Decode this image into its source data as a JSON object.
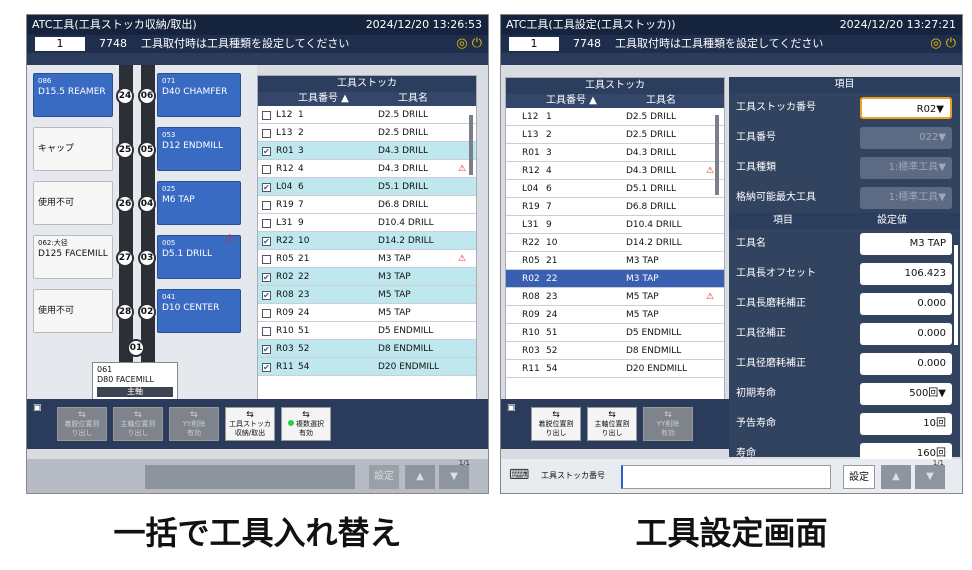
{
  "screen1": {
    "title": "ATC工具(工具ストッカ収納/取出)",
    "datetime": "2024/12/20 13:26:53",
    "number": "1",
    "code": "7748",
    "message": "工具取付時は工具種類を設定してください",
    "magazine": [
      {
        "name": "D15.5 REAMER",
        "pot_small": "086",
        "pot": "24",
        "blue": true
      },
      {
        "name": "D40 CHAMFER",
        "pot_small": "071",
        "pot": "06",
        "blue": true
      },
      {
        "name": "キャップ",
        "pot": "25",
        "blue": false
      },
      {
        "name": "D12 ENDMILL",
        "pot_small": "053",
        "pot": "05",
        "blue": true
      },
      {
        "name": "使用不可",
        "pot": "26",
        "blue": false
      },
      {
        "name": "M6 TAP",
        "pot_small": "025",
        "pot": "04",
        "blue": true
      },
      {
        "name": "D125 FACEMILL",
        "pot_small": "062:大径",
        "pot": "27",
        "blue": false
      },
      {
        "name": "D5.1 DRILL",
        "pot_small": "005",
        "pot": "03",
        "blue": true
      },
      {
        "name": "使用不可",
        "pot": "28",
        "blue": false
      },
      {
        "name": "D10 CENTER",
        "pot_small": "041",
        "pot": "02",
        "blue": true
      }
    ],
    "pot01": "01",
    "spindle": {
      "small": "061",
      "name": "D80 FACEMILL",
      "label": "主軸"
    },
    "table": {
      "title": "工具ストッカ",
      "col_no": "工具番号 ▲",
      "col_name": "工具名",
      "rows": [
        {
          "pos": "L12",
          "no": "1",
          "name": "D2.5 DRILL",
          "checked": false,
          "hl": false,
          "warn": false
        },
        {
          "pos": "L13",
          "no": "2",
          "name": "D2.5 DRILL",
          "checked": false,
          "hl": false,
          "warn": false
        },
        {
          "pos": "R01",
          "no": "3",
          "name": "D4.3 DRILL",
          "checked": true,
          "hl": true,
          "warn": false
        },
        {
          "pos": "R12",
          "no": "4",
          "name": "D4.3 DRILL",
          "checked": false,
          "hl": false,
          "warn": true
        },
        {
          "pos": "L04",
          "no": "6",
          "name": "D5.1 DRILL",
          "checked": true,
          "hl": true,
          "warn": false
        },
        {
          "pos": "R19",
          "no": "7",
          "name": "D6.8 DRILL",
          "checked": false,
          "hl": false,
          "warn": false
        },
        {
          "pos": "L31",
          "no": "9",
          "name": "D10.4 DRILL",
          "checked": false,
          "hl": false,
          "warn": false
        },
        {
          "pos": "R22",
          "no": "10",
          "name": "D14.2 DRILL",
          "checked": true,
          "hl": true,
          "warn": false
        },
        {
          "pos": "R05",
          "no": "21",
          "name": "M3 TAP",
          "checked": false,
          "hl": false,
          "warn": true
        },
        {
          "pos": "R02",
          "no": "22",
          "name": "M3 TAP",
          "checked": true,
          "hl": true,
          "warn": false
        },
        {
          "pos": "R08",
          "no": "23",
          "name": "M5 TAP",
          "checked": true,
          "hl": true,
          "warn": false
        },
        {
          "pos": "R09",
          "no": "24",
          "name": "M5 TAP",
          "checked": false,
          "hl": false,
          "warn": false
        },
        {
          "pos": "R10",
          "no": "51",
          "name": "D5 ENDMILL",
          "checked": false,
          "hl": false,
          "warn": false
        },
        {
          "pos": "R03",
          "no": "52",
          "name": "D8 ENDMILL",
          "checked": true,
          "hl": true,
          "warn": false
        },
        {
          "pos": "R11",
          "no": "54",
          "name": "D20 ENDMILL",
          "checked": true,
          "hl": true,
          "warn": false
        }
      ]
    },
    "buttons": [
      "着脱位置割\nり出し",
      "主軸位置割\nり出し",
      "YY削除\n有効",
      "工具ストッカ\n収納/取出",
      "複数選択\n有効"
    ],
    "page": "1/1",
    "set_label": "設定"
  },
  "screen2": {
    "title": "ATC工具(工具設定(工具ストッカ))",
    "datetime": "2024/12/20 13:27:21",
    "number": "1",
    "code": "7748",
    "message": "工具取付時は工具種類を設定してください",
    "table": {
      "title": "工具ストッカ",
      "col_no": "工具番号 ▲",
      "col_name": "工具名",
      "rows": [
        {
          "pos": "L12",
          "no": "1",
          "name": "D2.5 DRILL",
          "warn": false,
          "sel": false
        },
        {
          "pos": "L13",
          "no": "2",
          "name": "D2.5 DRILL",
          "warn": false,
          "sel": false
        },
        {
          "pos": "R01",
          "no": "3",
          "name": "D4.3 DRILL",
          "warn": false,
          "sel": false
        },
        {
          "pos": "R12",
          "no": "4",
          "name": "D4.3 DRILL",
          "warn": true,
          "sel": false
        },
        {
          "pos": "L04",
          "no": "6",
          "name": "D5.1 DRILL",
          "warn": false,
          "sel": false
        },
        {
          "pos": "R19",
          "no": "7",
          "name": "D6.8 DRILL",
          "warn": false,
          "sel": false
        },
        {
          "pos": "L31",
          "no": "9",
          "name": "D10.4 DRILL",
          "warn": false,
          "sel": false
        },
        {
          "pos": "R22",
          "no": "10",
          "name": "D14.2 DRILL",
          "warn": false,
          "sel": false
        },
        {
          "pos": "R05",
          "no": "21",
          "name": "M3 TAP",
          "warn": false,
          "sel": false
        },
        {
          "pos": "R02",
          "no": "22",
          "name": "M3 TAP",
          "warn": false,
          "sel": true
        },
        {
          "pos": "R08",
          "no": "23",
          "name": "M5 TAP",
          "warn": true,
          "sel": false
        },
        {
          "pos": "R09",
          "no": "24",
          "name": "M5 TAP",
          "warn": false,
          "sel": false
        },
        {
          "pos": "R10",
          "no": "51",
          "name": "D5 ENDMILL",
          "warn": false,
          "sel": false
        },
        {
          "pos": "R03",
          "no": "52",
          "name": "D8 ENDMILL",
          "warn": false,
          "sel": false
        },
        {
          "pos": "R11",
          "no": "54",
          "name": "D20 ENDMILL",
          "warn": false,
          "sel": false
        }
      ]
    },
    "settings_header": "項目",
    "settings_top": [
      {
        "label": "工具ストッカ番号",
        "value": "R02▼",
        "state": "act"
      },
      {
        "label": "工具番号",
        "value": "022▼",
        "state": "dis"
      },
      {
        "label": "工具種類",
        "value": "1:標準工具▼",
        "state": "dis"
      },
      {
        "label": "格納可能最大工具",
        "value": "1:標準工具▼",
        "state": "dis"
      }
    ],
    "col_item": "項目",
    "col_value": "設定値",
    "settings": [
      {
        "label": "工具名",
        "value": "M3 TAP"
      },
      {
        "label": "工具長オフセット",
        "value": "106.423"
      },
      {
        "label": "工具長磨耗補正",
        "value": "0.000"
      },
      {
        "label": "工具径補正",
        "value": "0.000"
      },
      {
        "label": "工具径磨耗補正",
        "value": "0.000"
      },
      {
        "label": "初期寿命",
        "value": "500回▼"
      },
      {
        "label": "予告寿命",
        "value": "10回"
      },
      {
        "label": "寿命",
        "value": "160回"
      }
    ],
    "buttons": [
      "着脱位置割\nり出し",
      "主軸位置割\nり出し",
      "YY削除\n有効"
    ],
    "footer_label": "工具ストッカ番号",
    "page": "1/1",
    "set_label": "設定"
  },
  "captions": [
    "一括で工具入れ替え",
    "工具設定画面"
  ]
}
